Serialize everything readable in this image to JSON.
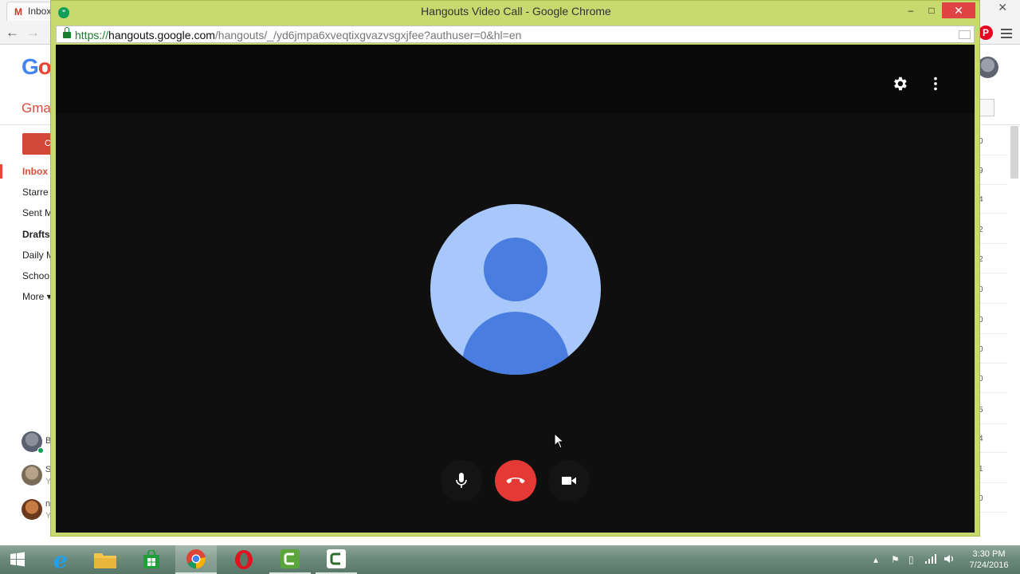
{
  "background_browser": {
    "tab_title": "Inbox",
    "tab_favicon_glyph": "M",
    "close_glyph": "✕",
    "back_glyph": "←",
    "forward_glyph": "→",
    "extension_glyph": "P",
    "google_logo": {
      "letter1": "G",
      "letter2": "o"
    },
    "gmail_label": "Gma",
    "compose_label": "C",
    "nav_items": [
      "Inbox",
      "Starre",
      "Sent M",
      "Drafts",
      "Daily M",
      "Schoo",
      "More ▾"
    ],
    "contacts": [
      {
        "initial": "B",
        "sub": ""
      },
      {
        "initial": "S",
        "sub": "Y"
      },
      {
        "initial": "n",
        "sub": "Y"
      }
    ],
    "row_digits": [
      "0",
      "9",
      "4",
      "2",
      "2",
      "0",
      "0",
      "0",
      "0",
      "5",
      "4",
      "1",
      "0"
    ]
  },
  "popup": {
    "window_title": "Hangouts Video Call - Google Chrome",
    "hangouts_glyph": "”",
    "controls": {
      "minimize": "–",
      "maximize": "□",
      "close": "✕"
    },
    "url": {
      "scheme": "https://",
      "host": "hangouts.google.com",
      "path": "/hangouts/_/yd6jmpa6xveqtixgvazvsgxjfee?authuser=0&hl=en"
    }
  },
  "call": {
    "top_actions": [
      {
        "name": "settings-icon",
        "icon": "gear"
      },
      {
        "name": "more-options-icon",
        "icon": "vertical-dots"
      }
    ],
    "participant_avatar": "default-person-icon",
    "buttons": [
      {
        "name": "mute-mic-button",
        "icon": "microphone"
      },
      {
        "name": "hang-up-button",
        "icon": "phone-hangup",
        "color": "#e53935"
      },
      {
        "name": "toggle-camera-button",
        "icon": "video-camera"
      }
    ]
  },
  "taskbar": {
    "items": [
      {
        "name": "start-button",
        "icon": "windows-logo"
      },
      {
        "name": "internet-explorer-taskbar-item",
        "icon": "ie-icon"
      },
      {
        "name": "file-explorer-taskbar-item",
        "icon": "folder-icon"
      },
      {
        "name": "store-taskbar-item",
        "icon": "store-icon"
      },
      {
        "name": "chrome-taskbar-item",
        "icon": "chrome-icon"
      },
      {
        "name": "opera-taskbar-item",
        "icon": "opera-icon"
      },
      {
        "name": "camtasia-taskbar-item",
        "icon": "camtasia-icon"
      },
      {
        "name": "camtasia-recorder-taskbar-item",
        "icon": "camtasia-recorder-icon"
      }
    ],
    "tray": {
      "chevron": "▴",
      "flag": "⚑",
      "battery": "▯",
      "volume": "🔊"
    },
    "time": "3:30 PM",
    "date": "7/24/2016"
  },
  "colors": {
    "popup_frame": "#c7d96f",
    "call_background": "#0f0f0f",
    "avatar_light": "#a8c7fa",
    "avatar_dark": "#4a7de0",
    "hangup_red": "#e53935",
    "url_green": "#1a7f2e"
  }
}
